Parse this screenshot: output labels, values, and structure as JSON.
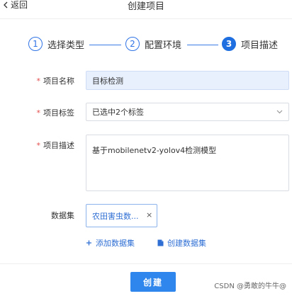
{
  "header": {
    "back_label": "返回",
    "title": "创建项目"
  },
  "steps": [
    {
      "number": "1",
      "label": "选择类型"
    },
    {
      "number": "2",
      "label": "配置环境"
    },
    {
      "number": "3",
      "label": "项目描述"
    }
  ],
  "form": {
    "project_name": {
      "label": "项目名称",
      "value": "目标检测"
    },
    "project_tags": {
      "label": "项目标签",
      "value": "已选中2个标签"
    },
    "project_desc": {
      "label": "项目描述",
      "value": "基于mobilenetv2-yolov4检测模型"
    },
    "dataset": {
      "label": "数据集",
      "tag": "农田害虫数...",
      "close": "×",
      "add_label": "添加数据集",
      "create_label": "创建数据集"
    }
  },
  "footer": {
    "create_label": "创建",
    "watermark": "CSDN @勇敢的牛牛@"
  },
  "colors": {
    "accent": "#2f86ec",
    "required": "#e34d4d",
    "link": "#2f6fd4"
  }
}
